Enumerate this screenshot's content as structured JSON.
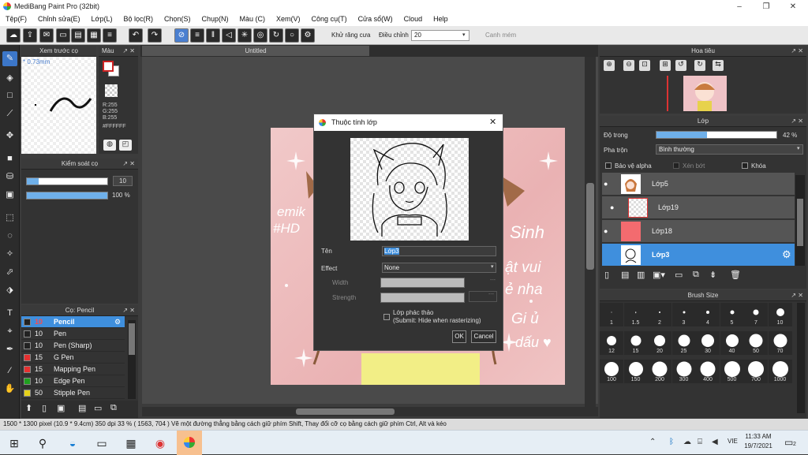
{
  "window": {
    "title": "MediBang Paint Pro (32bit)"
  },
  "menu": [
    "Tệp(F)",
    "Chỉnh sửa(E)",
    "Lớp(L)",
    "Bộ lọc(R)",
    "Chọn(S)",
    "Chụp(N)",
    "Màu (C)",
    "Xem(V)",
    "Công cụ(T)",
    "Cửa sổ(W)",
    "Cloud",
    "Help"
  ],
  "toolbar": {
    "antialias_label": "Khử răng cưa",
    "correction_label": "Điều chỉnh",
    "correction_value": "20",
    "snap_label": "Canh mém"
  },
  "brush_preview": {
    "title": "Xem trước cọ",
    "size": "* 0.73mm"
  },
  "color_panel": {
    "title": "Màu",
    "r": "R:255",
    "g": "G:255",
    "b": "B:255",
    "hex": "#FFFFFF"
  },
  "brush_control": {
    "title": "Kiểm soát cọ",
    "size_value": "10",
    "opacity_value": "100 %",
    "size_fraction": 0.15,
    "opacity_fraction": 1.0
  },
  "canvas": {
    "tab": "Untitled",
    "art_text_left": [
      "emik",
      "#HD"
    ],
    "art_text_right": [
      "Sinh",
      "ật vui",
      "ẻ nha",
      "Gi ủ",
      "dấu ♥"
    ]
  },
  "dialog": {
    "title": "Thuộc tính lớp",
    "name_label": "Tên",
    "name_value": "Lớp3",
    "effect_label": "Effect",
    "effect_value": "None",
    "width_label": "Width",
    "strength_label": "Strength",
    "sketch_label": "Lớp phác thảo",
    "sketch_sub": "(Submit: Hide when rasterizing)",
    "ok": "OK",
    "cancel": "Cancel",
    "dots1": "---",
    "dots2": "---"
  },
  "brush_list": {
    "title": "Cọ: Pencil",
    "items": [
      {
        "size": "10",
        "name": "Pencil",
        "color": "#222222"
      },
      {
        "size": "10",
        "name": "Pen",
        "color": "#222222"
      },
      {
        "size": "10",
        "name": "Pen (Sharp)",
        "color": "#222222"
      },
      {
        "size": "15",
        "name": "G Pen",
        "color": "#e53030"
      },
      {
        "size": "15",
        "name": "Mapping Pen",
        "color": "#e53030"
      },
      {
        "size": "10",
        "name": "Edge Pen",
        "color": "#1fa01f"
      },
      {
        "size": "50",
        "name": "Stipple Pen",
        "color": "#e6d21a"
      }
    ]
  },
  "navigator": {
    "title": "Hoa tiêu"
  },
  "layer_panel": {
    "title": "Lớp",
    "opacity_label": "Độ trong",
    "opacity_value": "42 %",
    "opacity_fraction": 0.42,
    "blend_label": "Pha trộn",
    "blend_value": "Bình thường",
    "protect_alpha": "Bảo vệ alpha",
    "clipping": "Xén bớt",
    "lock": "Khóa",
    "layers": [
      {
        "name": "Lớp5"
      },
      {
        "name": "Lớp19"
      },
      {
        "name": "Lớp18"
      },
      {
        "name": "Lớp3"
      }
    ]
  },
  "brush_size": {
    "title": "Brush Size",
    "sizes": [
      "1",
      "1.5",
      "2",
      "3",
      "4",
      "5",
      "7",
      "10",
      "12",
      "15",
      "20",
      "25",
      "30",
      "40",
      "50",
      "70",
      "100",
      "150",
      "200",
      "300",
      "400",
      "500",
      "700",
      "1000"
    ]
  },
  "status": {
    "text": "1500 * 1300 pixel  (10.9 * 9.4cm)  350 dpi  33 %  ( 1563, 704 )  Vẽ một đường thẳng bằng cách giữ phím Shift, Thay đổi cỡ cọ bằng cách giữ phím Ctrl, Alt và kéo"
  },
  "taskbar": {
    "time": "11:33 AM",
    "date": "19/7/2021",
    "notif": "2",
    "lang": "VIE"
  }
}
